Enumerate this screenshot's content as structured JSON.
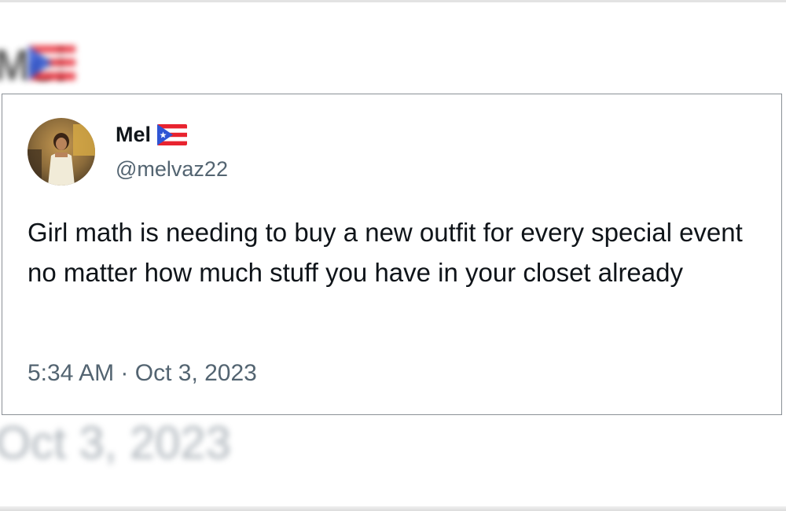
{
  "background": {
    "blurred_name": "Mel",
    "blurred_date": "Oct 3, 2023"
  },
  "tweet": {
    "display_name": "Mel",
    "flag_icon": "puerto-rico-flag-icon",
    "handle": "@melvaz22",
    "text": "Girl math is needing to buy a new outfit for every special event no matter how much stuff you have in your closet already",
    "time": "5:34 AM",
    "separator": "·",
    "date": "Oct 3, 2023"
  },
  "colors": {
    "text_primary": "#0f1419",
    "text_secondary": "#536471",
    "card_border": "#8a9096",
    "flag_red": "#e8232f",
    "flag_blue": "#2f55d4"
  }
}
